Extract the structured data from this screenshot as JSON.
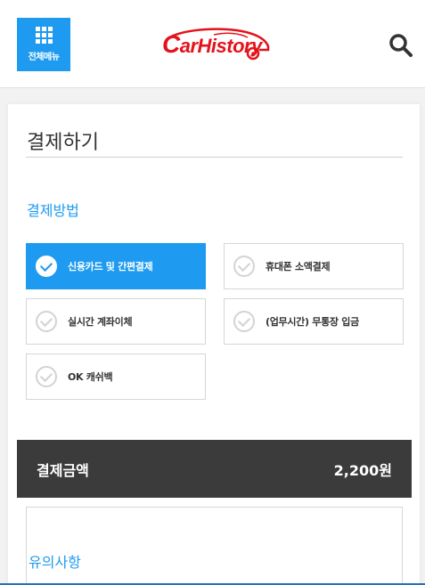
{
  "header": {
    "menu_label": "전체메뉴",
    "logo": {
      "text_first": "C",
      "text_rest": "arHistory"
    },
    "search_icon": "search-icon"
  },
  "page": {
    "title": "결제하기",
    "section_label": "결제방법"
  },
  "payment_options": [
    {
      "label": "신용카드 및 간편결제",
      "selected": true
    },
    {
      "label": "휴대폰 소액결제",
      "selected": false
    },
    {
      "label": "실시간 계좌이체",
      "selected": false
    },
    {
      "label": "(업무시간) 무통장 입금",
      "selected": false
    },
    {
      "label": "OK 캐쉬백",
      "selected": false
    }
  ],
  "total": {
    "label": "결제금액",
    "value": "2,200원"
  },
  "notice": {
    "title": "유의사항"
  },
  "colors": {
    "accent": "#1e9bf0",
    "logo_red": "#e5121b",
    "total_bar": "#3b3b3b"
  }
}
